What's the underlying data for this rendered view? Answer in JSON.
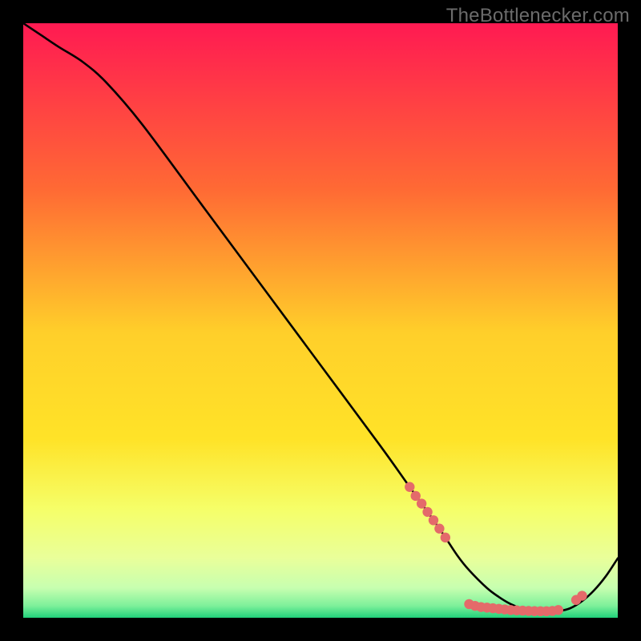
{
  "watermark": "TheBottlenecker.com",
  "colors": {
    "frame": "#000000",
    "curve": "#000000",
    "markers": "#e46a6a",
    "grad_top": "#ff1a52",
    "grad_mid_upper": "#ff8a2a",
    "grad_mid": "#ffe328",
    "grad_mid_lower": "#f3ff66",
    "grad_band": "#d9ffb0",
    "grad_bottom": "#21d07a"
  },
  "chart_data": {
    "type": "line",
    "title": "",
    "xlabel": "",
    "ylabel": "",
    "xlim": [
      0,
      100
    ],
    "ylim": [
      0,
      100
    ],
    "series": [
      {
        "name": "curve",
        "x": [
          0,
          3,
          6,
          10,
          14,
          20,
          30,
          40,
          50,
          60,
          65,
          70,
          73,
          75,
          78,
          80,
          82,
          84,
          86,
          88,
          90,
          92,
          94,
          96,
          98,
          100
        ],
        "y": [
          100,
          98,
          96,
          93.5,
          90,
          83,
          69.5,
          56,
          42.5,
          29,
          22,
          15,
          10.5,
          8,
          5,
          3.5,
          2.3,
          1.5,
          1.1,
          1,
          1.1,
          1.6,
          2.8,
          4.6,
          7,
          10
        ]
      }
    ],
    "markers": {
      "name": "dense-segment",
      "points": [
        {
          "x": 65,
          "y": 22
        },
        {
          "x": 66,
          "y": 20.5
        },
        {
          "x": 67,
          "y": 19.2
        },
        {
          "x": 68,
          "y": 17.8
        },
        {
          "x": 69,
          "y": 16.4
        },
        {
          "x": 70,
          "y": 15
        },
        {
          "x": 71,
          "y": 13.5
        },
        {
          "x": 75,
          "y": 2.3
        },
        {
          "x": 76,
          "y": 2.0
        },
        {
          "x": 77,
          "y": 1.8
        },
        {
          "x": 78,
          "y": 1.7
        },
        {
          "x": 79,
          "y": 1.6
        },
        {
          "x": 80,
          "y": 1.5
        },
        {
          "x": 81,
          "y": 1.4
        },
        {
          "x": 82,
          "y": 1.3
        },
        {
          "x": 83,
          "y": 1.25
        },
        {
          "x": 84,
          "y": 1.2
        },
        {
          "x": 85,
          "y": 1.15
        },
        {
          "x": 86,
          "y": 1.12
        },
        {
          "x": 87,
          "y": 1.1
        },
        {
          "x": 88,
          "y": 1.1
        },
        {
          "x": 89,
          "y": 1.15
        },
        {
          "x": 90,
          "y": 1.3
        },
        {
          "x": 93,
          "y": 3.0
        },
        {
          "x": 94,
          "y": 3.7
        }
      ]
    }
  }
}
